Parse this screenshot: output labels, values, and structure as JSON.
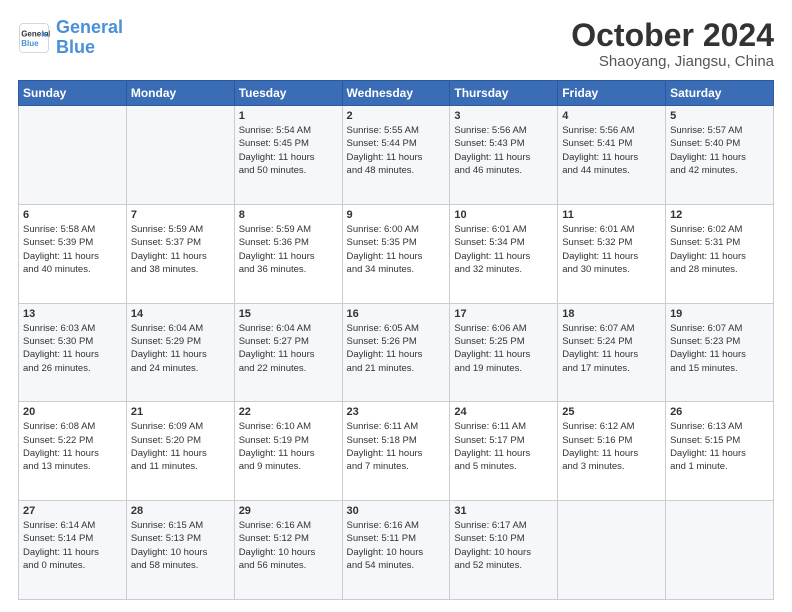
{
  "header": {
    "logo_general": "General",
    "logo_blue": "Blue",
    "month": "October 2024",
    "location": "Shaoyang, Jiangsu, China"
  },
  "days_of_week": [
    "Sunday",
    "Monday",
    "Tuesday",
    "Wednesday",
    "Thursday",
    "Friday",
    "Saturday"
  ],
  "weeks": [
    [
      {
        "day": "",
        "info": ""
      },
      {
        "day": "",
        "info": ""
      },
      {
        "day": "1",
        "info": "Sunrise: 5:54 AM\nSunset: 5:45 PM\nDaylight: 11 hours\nand 50 minutes."
      },
      {
        "day": "2",
        "info": "Sunrise: 5:55 AM\nSunset: 5:44 PM\nDaylight: 11 hours\nand 48 minutes."
      },
      {
        "day": "3",
        "info": "Sunrise: 5:56 AM\nSunset: 5:43 PM\nDaylight: 11 hours\nand 46 minutes."
      },
      {
        "day": "4",
        "info": "Sunrise: 5:56 AM\nSunset: 5:41 PM\nDaylight: 11 hours\nand 44 minutes."
      },
      {
        "day": "5",
        "info": "Sunrise: 5:57 AM\nSunset: 5:40 PM\nDaylight: 11 hours\nand 42 minutes."
      }
    ],
    [
      {
        "day": "6",
        "info": "Sunrise: 5:58 AM\nSunset: 5:39 PM\nDaylight: 11 hours\nand 40 minutes."
      },
      {
        "day": "7",
        "info": "Sunrise: 5:59 AM\nSunset: 5:37 PM\nDaylight: 11 hours\nand 38 minutes."
      },
      {
        "day": "8",
        "info": "Sunrise: 5:59 AM\nSunset: 5:36 PM\nDaylight: 11 hours\nand 36 minutes."
      },
      {
        "day": "9",
        "info": "Sunrise: 6:00 AM\nSunset: 5:35 PM\nDaylight: 11 hours\nand 34 minutes."
      },
      {
        "day": "10",
        "info": "Sunrise: 6:01 AM\nSunset: 5:34 PM\nDaylight: 11 hours\nand 32 minutes."
      },
      {
        "day": "11",
        "info": "Sunrise: 6:01 AM\nSunset: 5:32 PM\nDaylight: 11 hours\nand 30 minutes."
      },
      {
        "day": "12",
        "info": "Sunrise: 6:02 AM\nSunset: 5:31 PM\nDaylight: 11 hours\nand 28 minutes."
      }
    ],
    [
      {
        "day": "13",
        "info": "Sunrise: 6:03 AM\nSunset: 5:30 PM\nDaylight: 11 hours\nand 26 minutes."
      },
      {
        "day": "14",
        "info": "Sunrise: 6:04 AM\nSunset: 5:29 PM\nDaylight: 11 hours\nand 24 minutes."
      },
      {
        "day": "15",
        "info": "Sunrise: 6:04 AM\nSunset: 5:27 PM\nDaylight: 11 hours\nand 22 minutes."
      },
      {
        "day": "16",
        "info": "Sunrise: 6:05 AM\nSunset: 5:26 PM\nDaylight: 11 hours\nand 21 minutes."
      },
      {
        "day": "17",
        "info": "Sunrise: 6:06 AM\nSunset: 5:25 PM\nDaylight: 11 hours\nand 19 minutes."
      },
      {
        "day": "18",
        "info": "Sunrise: 6:07 AM\nSunset: 5:24 PM\nDaylight: 11 hours\nand 17 minutes."
      },
      {
        "day": "19",
        "info": "Sunrise: 6:07 AM\nSunset: 5:23 PM\nDaylight: 11 hours\nand 15 minutes."
      }
    ],
    [
      {
        "day": "20",
        "info": "Sunrise: 6:08 AM\nSunset: 5:22 PM\nDaylight: 11 hours\nand 13 minutes."
      },
      {
        "day": "21",
        "info": "Sunrise: 6:09 AM\nSunset: 5:20 PM\nDaylight: 11 hours\nand 11 minutes."
      },
      {
        "day": "22",
        "info": "Sunrise: 6:10 AM\nSunset: 5:19 PM\nDaylight: 11 hours\nand 9 minutes."
      },
      {
        "day": "23",
        "info": "Sunrise: 6:11 AM\nSunset: 5:18 PM\nDaylight: 11 hours\nand 7 minutes."
      },
      {
        "day": "24",
        "info": "Sunrise: 6:11 AM\nSunset: 5:17 PM\nDaylight: 11 hours\nand 5 minutes."
      },
      {
        "day": "25",
        "info": "Sunrise: 6:12 AM\nSunset: 5:16 PM\nDaylight: 11 hours\nand 3 minutes."
      },
      {
        "day": "26",
        "info": "Sunrise: 6:13 AM\nSunset: 5:15 PM\nDaylight: 11 hours\nand 1 minute."
      }
    ],
    [
      {
        "day": "27",
        "info": "Sunrise: 6:14 AM\nSunset: 5:14 PM\nDaylight: 11 hours\nand 0 minutes."
      },
      {
        "day": "28",
        "info": "Sunrise: 6:15 AM\nSunset: 5:13 PM\nDaylight: 10 hours\nand 58 minutes."
      },
      {
        "day": "29",
        "info": "Sunrise: 6:16 AM\nSunset: 5:12 PM\nDaylight: 10 hours\nand 56 minutes."
      },
      {
        "day": "30",
        "info": "Sunrise: 6:16 AM\nSunset: 5:11 PM\nDaylight: 10 hours\nand 54 minutes."
      },
      {
        "day": "31",
        "info": "Sunrise: 6:17 AM\nSunset: 5:10 PM\nDaylight: 10 hours\nand 52 minutes."
      },
      {
        "day": "",
        "info": ""
      },
      {
        "day": "",
        "info": ""
      }
    ]
  ]
}
